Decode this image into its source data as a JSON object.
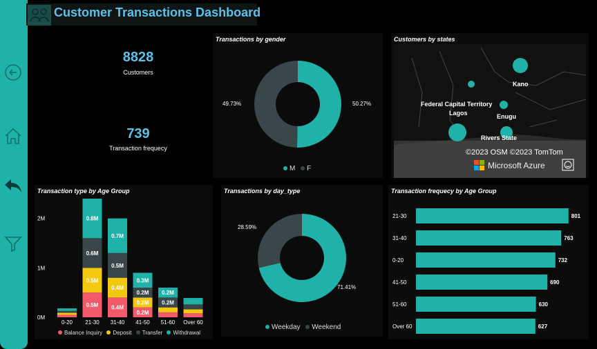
{
  "title": "Customer Transactions Dashboard",
  "colors": {
    "accent": "#20b2a8",
    "title": "#5dc2e8",
    "dark_series": "#39474a",
    "balance": "#f2596a",
    "deposit": "#f2c811"
  },
  "sidebar": {
    "icons": [
      "back-circle-icon",
      "home-icon",
      "undo-arrow-icon",
      "filter-icon"
    ]
  },
  "kpis": [
    {
      "value": "8828",
      "label": "Customers"
    },
    {
      "value": "739",
      "label": "Transaction frequecy"
    }
  ],
  "gender": {
    "title": "Transactions by gender",
    "slices": [
      {
        "name": "M",
        "value": 50.27,
        "label": "50.27%",
        "color": "#20b2a8"
      },
      {
        "name": "F",
        "value": 49.73,
        "label": "49.73%",
        "color": "#39474a"
      }
    ],
    "legend": [
      "M",
      "F"
    ]
  },
  "map": {
    "title": "Customers by states",
    "places": [
      {
        "name": "Kano",
        "size": "large"
      },
      {
        "name": "Federal Capital Territory",
        "size": "small"
      },
      {
        "name": "Enugu",
        "size": "small"
      },
      {
        "name": "Lagos",
        "size": "large"
      },
      {
        "name": "Rivers State",
        "size": "medium"
      }
    ],
    "attribution": "©2023 OSM ©2023 TomTom",
    "provider": "Microsoft Azure"
  },
  "daytype": {
    "title": "Transactions by day_type",
    "slices": [
      {
        "name": "Weekday",
        "value": 71.41,
        "label": "71.41%",
        "color": "#20b2a8"
      },
      {
        "name": "Weekend",
        "value": 28.59,
        "label": "28.59%",
        "color": "#39474a"
      }
    ],
    "legend": [
      "Weekday",
      "Weekend"
    ]
  },
  "chart_data": [
    {
      "type": "bar",
      "title": "Transaction type by Age Group",
      "stacked": true,
      "categories": [
        "0-20",
        "21-30",
        "31-40",
        "41-50",
        "51-60",
        "Over 60"
      ],
      "ylim": [
        0,
        2400000
      ],
      "yticks": [
        {
          "v": 0,
          "t": "0M"
        },
        {
          "v": 1000000,
          "t": "1M"
        },
        {
          "v": 2000000,
          "t": "2M"
        }
      ],
      "series": [
        {
          "name": "Balance Inquiry",
          "color": "#f2596a",
          "values": [
            50000,
            500000,
            400000,
            200000,
            100000,
            80000
          ],
          "labels": [
            "",
            "0.5M",
            "0.4M",
            "0.2M",
            "",
            ""
          ]
        },
        {
          "name": "Deposit",
          "color": "#f2c811",
          "values": [
            40000,
            500000,
            400000,
            200000,
            100000,
            80000
          ],
          "labels": [
            "",
            "0.5M",
            "0.4M",
            "0.2M",
            "",
            ""
          ]
        },
        {
          "name": "Transfer",
          "color": "#39474a",
          "values": [
            40000,
            600000,
            500000,
            200000,
            200000,
            100000
          ],
          "labels": [
            "",
            "0.6M",
            "0.5M",
            "0.2M",
            "0.2M",
            ""
          ]
        },
        {
          "name": "Withdrawal",
          "color": "#20b2a8",
          "values": [
            50000,
            800000,
            700000,
            300000,
            200000,
            130000
          ],
          "labels": [
            "",
            "0.8M",
            "0.7M",
            "0.3M",
            "0.2M",
            ""
          ]
        }
      ],
      "legend": [
        "Balance Inquiry",
        "Deposit",
        "Transfer",
        "Withdrawal"
      ]
    },
    {
      "type": "bar",
      "orientation": "horizontal",
      "title": "Transaction frequecy by Age Group",
      "categories": [
        "21-30",
        "31-40",
        "0-20",
        "41-50",
        "51-60",
        "Over 60"
      ],
      "values": [
        801,
        763,
        732,
        690,
        630,
        627
      ],
      "labels": [
        "801",
        "763",
        "732",
        "690",
        "630",
        "627"
      ],
      "xlim": [
        0,
        820
      ],
      "color": "#20b2a8"
    }
  ]
}
